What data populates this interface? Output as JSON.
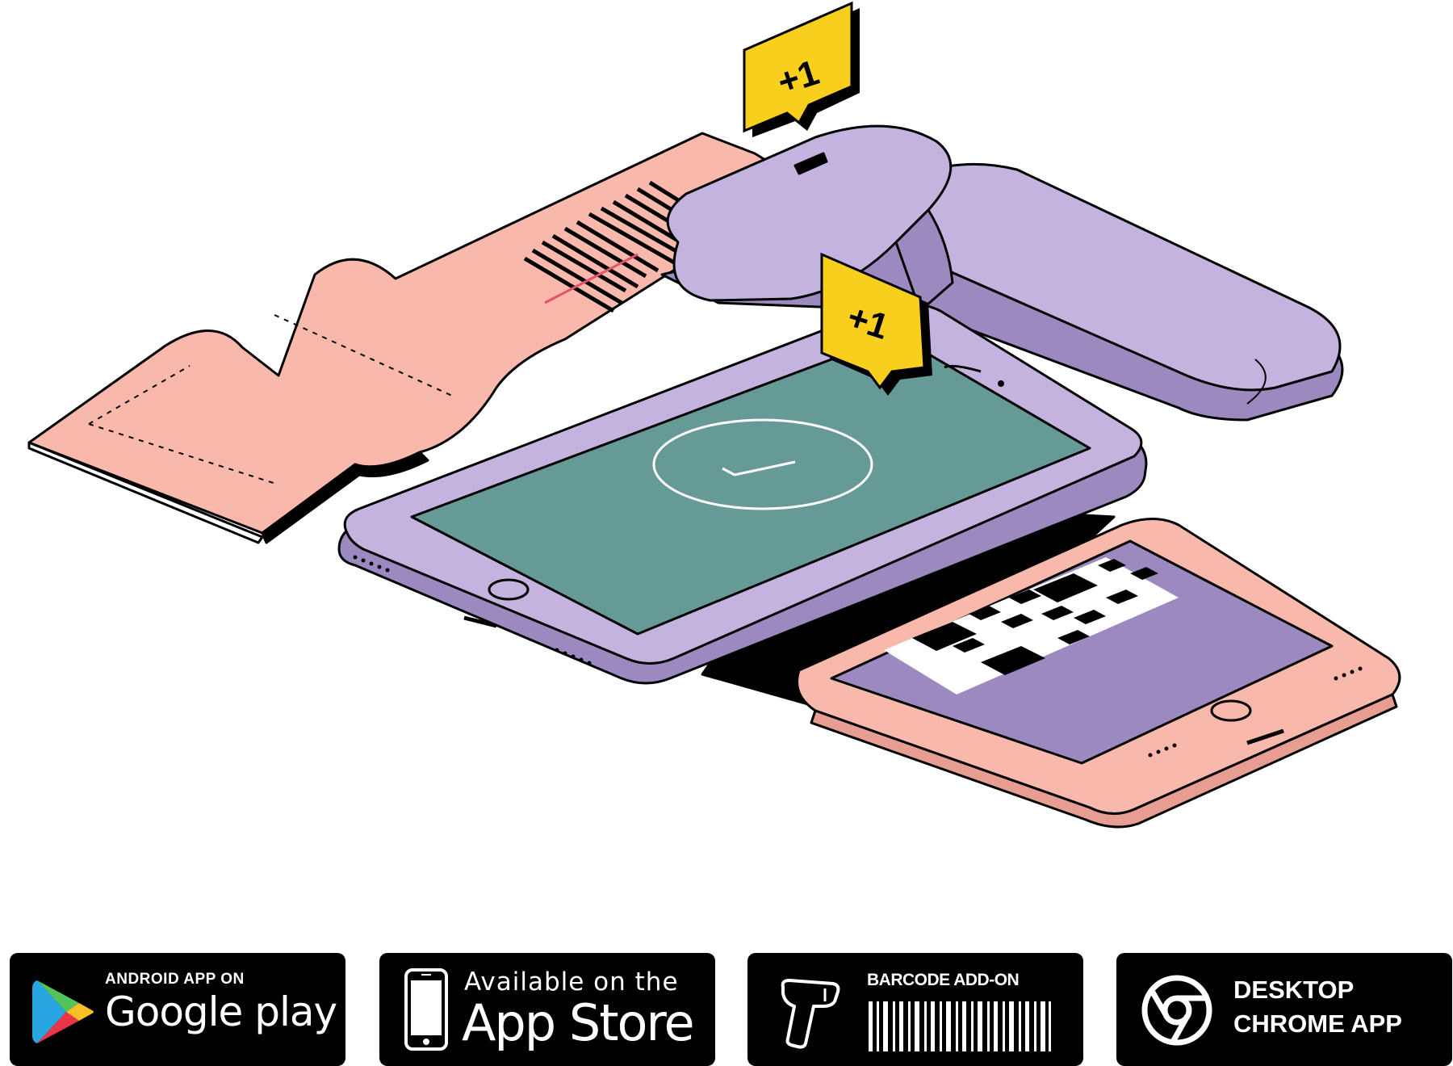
{
  "notifications": {
    "scanner_badge": "+1",
    "tablet_badge": "+1"
  },
  "badges": {
    "google_play": {
      "small_text": "ANDROID APP ON",
      "big_text": "Google play",
      "icon": "play-triangle-icon"
    },
    "app_store": {
      "small_text": "Available on the",
      "big_text": "App Store",
      "icon": "phone-icon"
    },
    "barcode_addon": {
      "small_text": "BARCODE ADD-ON",
      "icon": "barcode-scanner-icon"
    },
    "chrome_app": {
      "line1": "DESKTOP",
      "line2": "CHROME APP",
      "icon": "chrome-icon"
    }
  },
  "colors": {
    "paper": "#f8b8ac",
    "scanner": "#c3b3de",
    "scanner_shadow": "#9b89c0",
    "tablet_screen": "#669a97",
    "phone_body": "#f8b8ac",
    "phone_screen": "#9b89c0",
    "notification": "#f9cf1d",
    "badge_bg": "#000000"
  }
}
